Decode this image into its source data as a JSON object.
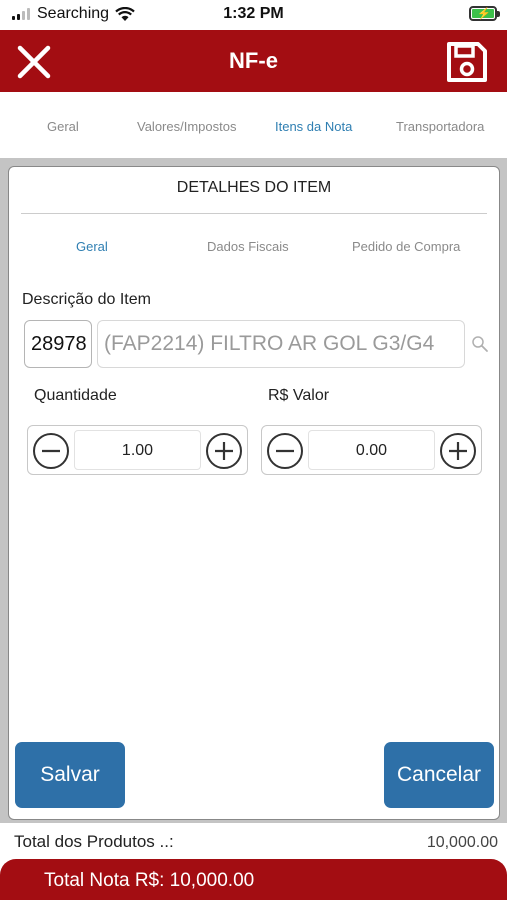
{
  "status_bar": {
    "carrier": "Searching",
    "time": "1:32 PM"
  },
  "header": {
    "title": "NF-e"
  },
  "top_tabs": [
    {
      "label": "Geral",
      "active": false
    },
    {
      "label": "Valores/Impostos",
      "active": false
    },
    {
      "label": "Itens da Nota",
      "active": true
    },
    {
      "label": "Transportadora",
      "active": false
    }
  ],
  "modal": {
    "title": "DETALHES DO ITEM",
    "sub_tabs": [
      {
        "label": "Geral",
        "active": true
      },
      {
        "label": "Dados Fiscais",
        "active": false
      },
      {
        "label": "Pedido de Compra",
        "active": false
      }
    ],
    "item_description_label": "Descrição do Item",
    "item_code": "28978",
    "item_description": "(FAP2214) FILTRO AR GOL G3/G4",
    "quantity_label": "Quantidade",
    "quantity_value": "1.00",
    "price_label": "R$ Valor",
    "price_value": "0.00",
    "save_label": "Salvar",
    "cancel_label": "Cancelar"
  },
  "totals": {
    "products_label": "Total dos Produtos ..:",
    "products_value": "10,000.00",
    "note_total": "Total Nota R$: 10,000.00"
  },
  "colors": {
    "header_red": "#a30d12",
    "accent_blue": "#2f7fb2",
    "button_blue": "#2e70a8"
  },
  "icons": {
    "close": "close-icon",
    "save": "floppy-disk-icon",
    "search": "search-icon",
    "minus": "minus-circle-icon",
    "plus": "plus-circle-icon"
  }
}
